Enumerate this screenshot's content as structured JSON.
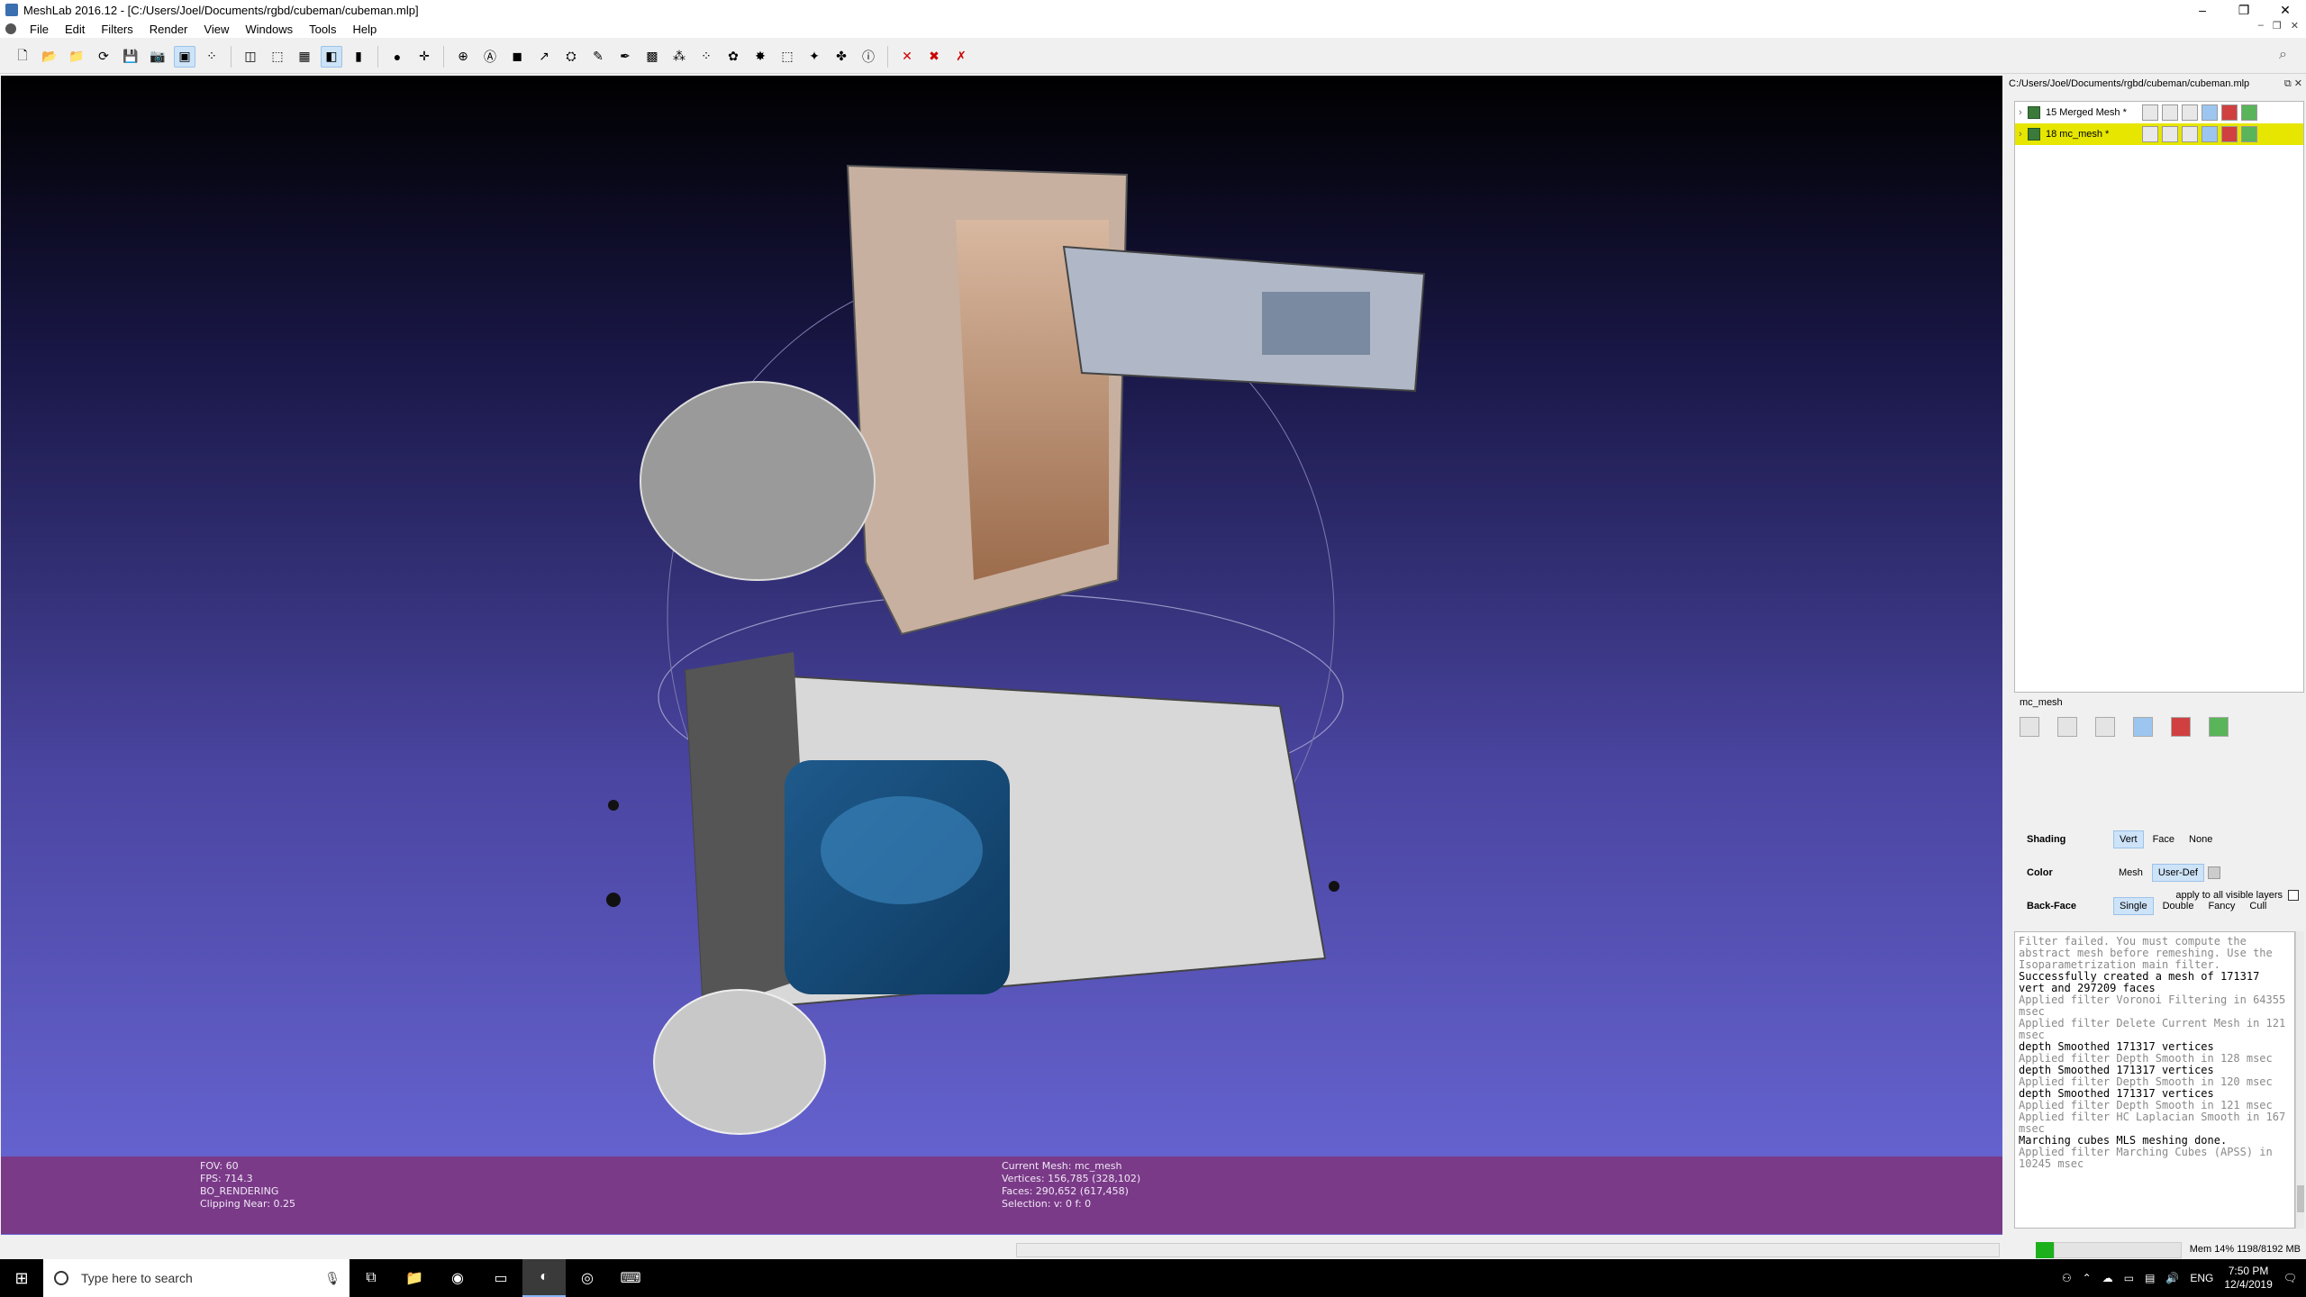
{
  "window": {
    "title": "MeshLab 2016.12 - [C:/Users/Joel/Documents/rgbd/cubeman/cubeman.mlp]",
    "controls": [
      "–",
      "❐",
      "✕"
    ],
    "mdi_controls": [
      "–",
      "❐",
      "✕"
    ]
  },
  "menu": [
    "File",
    "Edit",
    "Filters",
    "Render",
    "View",
    "Windows",
    "Tools",
    "Help"
  ],
  "toolbar": {
    "icons": [
      "new-icon",
      "open-project-icon",
      "open-icon",
      "reload-icon",
      "save-icon",
      "snapshot-icon",
      "bounding-box-icon",
      "points-icon",
      "wireframe-icon",
      "hidden-lines-icon",
      "flat-icon",
      "smooth-icon",
      "texture-icon",
      "light-icon",
      "trackball-icon",
      "measure-icon",
      "annotation-icon",
      "align-icon",
      "manipulator-icon",
      "paint-icon",
      "pickpoints-icon",
      "select-faces-icon",
      "select-vertices-icon",
      "select-connected-icon",
      "z-paint-icon",
      "info-icon",
      "delete-selection-icon",
      "delete-faces-icon",
      "delete-vertices-icon"
    ]
  },
  "viewport": {
    "hud_left": [
      "FOV: 60",
      "FPS:   714.3",
      "BO_RENDERING",
      "Clipping Near:   0.25"
    ],
    "hud_mid": [
      "Current Mesh: mc_mesh",
      "Vertices: 156,785    (328,102)",
      "Faces: 290,652    (617,458)",
      "Selection: v: 0 f: 0"
    ]
  },
  "panel": {
    "path": "C:/Users/Joel/Documents/rgbd/cubeman/cubeman.mlp",
    "header_controls": "⧉ ✕",
    "layers": [
      {
        "label": "15  Merged Mesh *",
        "active": false
      },
      {
        "label": "18  mc_mesh *",
        "active": true
      }
    ],
    "props_title": "mc_mesh",
    "shading": {
      "label": "Shading",
      "options": [
        "Vert",
        "Face",
        "None"
      ],
      "selected": "Vert"
    },
    "color": {
      "label": "Color",
      "options": [
        "Mesh",
        "User-Def"
      ],
      "selected": "User-Def"
    },
    "backface": {
      "label": "Back-Face",
      "options": [
        "Single",
        "Double",
        "Fancy",
        "Cull"
      ],
      "selected": "Single"
    },
    "apply_all": "apply to all visible layers"
  },
  "log": [
    {
      "t": "Filter failed. You must compute the abstract mesh before remeshing. Use the Isoparametrization main filter.",
      "k": "g"
    },
    {
      "t": "Successfully created a mesh of 171317 vert and 297209 faces",
      "k": "b"
    },
    {
      "t": "Applied filter Voronoi Filtering in 64355 msec",
      "k": "g"
    },
    {
      "t": "Applied filter Delete Current Mesh in 121 msec",
      "k": "g"
    },
    {
      "t": "depth Smoothed 171317 vertices",
      "k": "b"
    },
    {
      "t": "Applied filter Depth Smooth in 128 msec",
      "k": "g"
    },
    {
      "t": "depth Smoothed 171317 vertices",
      "k": "b"
    },
    {
      "t": "Applied filter Depth Smooth in 120 msec",
      "k": "g"
    },
    {
      "t": "depth Smoothed 171317 vertices",
      "k": "b"
    },
    {
      "t": "Applied filter Depth Smooth in 121 msec",
      "k": "g"
    },
    {
      "t": "Applied filter HC Laplacian Smooth in 167 msec",
      "k": "g"
    },
    {
      "t": "Marching cubes MLS meshing done.",
      "k": "b"
    },
    {
      "t": "Applied filter Marching Cubes (APSS) in 10245 msec",
      "k": "g"
    }
  ],
  "status": {
    "mem": "Mem 14% 1198/8192 MB"
  },
  "taskbar": {
    "search_placeholder": "Type here to search",
    "lang": "ENG",
    "time": "7:50 PM",
    "date": "12/4/2019"
  }
}
